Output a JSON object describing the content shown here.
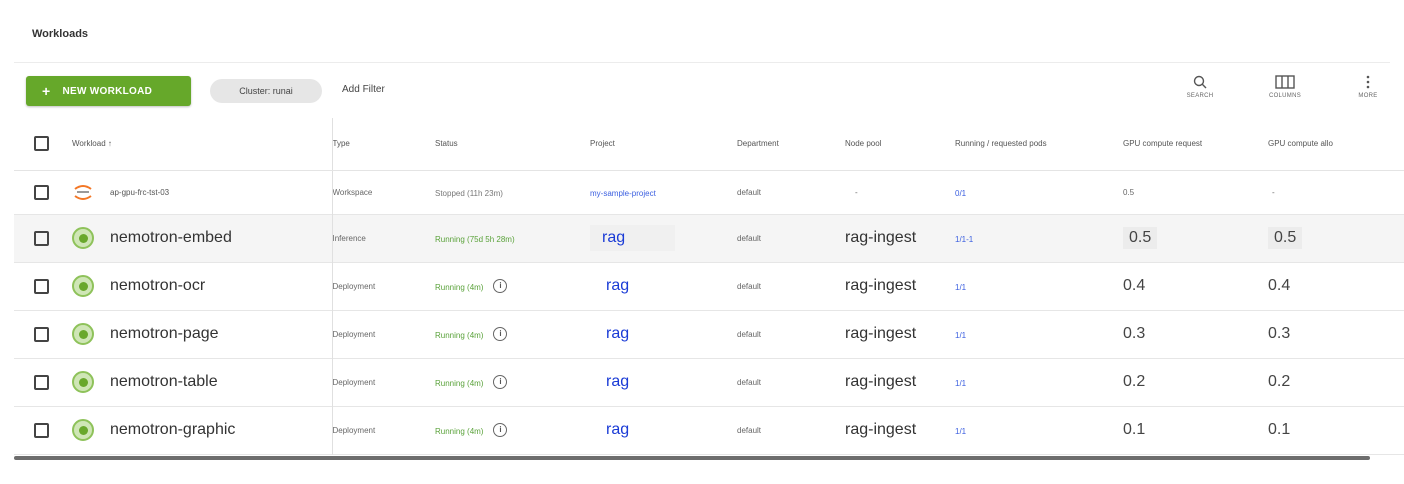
{
  "page": {
    "title": "Workloads"
  },
  "toolbar": {
    "new_workload_label": "NEW WORKLOAD",
    "cluster_chip": "Cluster: runai",
    "add_filter": "Add Filter",
    "search_label": "SEARCH",
    "columns_label": "COLUMNS",
    "more_label": "MORE"
  },
  "table": {
    "headers": {
      "workload": "Workload ↑",
      "type": "Type",
      "status": "Status",
      "project": "Project",
      "department": "Department",
      "node_pool": "Node pool",
      "running": "Running / requested pods",
      "gpu_request": "GPU compute request",
      "gpu_alloc": "GPU compute allo"
    },
    "rows": [
      {
        "name": "ap-gpu-frc-tst-03",
        "type": "Workspace",
        "status": "Stopped (11h 23m)",
        "project": "my-sample-project",
        "department": "default",
        "node_pool": "-",
        "running": "0/1",
        "gpu_request": "0.5",
        "gpu_alloc": "-"
      },
      {
        "name": "nemotron-embed",
        "type": "Inference",
        "status": "Running (75d 5h 28m)",
        "project": "rag",
        "department": "default",
        "node_pool": "rag-ingest",
        "running": "1/1-1",
        "gpu_request": "0.5",
        "gpu_alloc": "0.5"
      },
      {
        "name": "nemotron-ocr",
        "type": "Deployment",
        "status": "Running (4m)",
        "project": "rag",
        "department": "default",
        "node_pool": "rag-ingest",
        "running": "1/1",
        "gpu_request": "0.4",
        "gpu_alloc": "0.4"
      },
      {
        "name": "nemotron-page",
        "type": "Deployment",
        "status": "Running (4m)",
        "project": "rag",
        "department": "default",
        "node_pool": "rag-ingest",
        "running": "1/1",
        "gpu_request": "0.3",
        "gpu_alloc": "0.3"
      },
      {
        "name": "nemotron-table",
        "type": "Deployment",
        "status": "Running (4m)",
        "project": "rag",
        "department": "default",
        "node_pool": "rag-ingest",
        "running": "1/1",
        "gpu_request": "0.2",
        "gpu_alloc": "0.2"
      },
      {
        "name": "nemotron-graphic",
        "type": "Deployment",
        "status": "Running (4m)",
        "project": "rag",
        "department": "default",
        "node_pool": "rag-ingest",
        "running": "1/1",
        "gpu_request": "0.1",
        "gpu_alloc": "0.1"
      }
    ]
  },
  "icons": {
    "info": "i",
    "nvidia_icon": "nim-icon",
    "jupyter_icon": "jupyter-icon"
  },
  "colors": {
    "primary_button": "#66a82a",
    "link": "#1a3bd6",
    "running_status": "#5aa23a"
  }
}
